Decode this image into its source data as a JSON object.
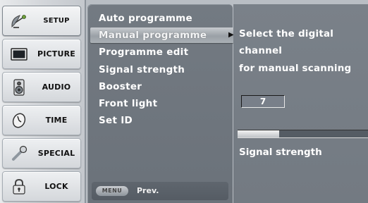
{
  "sidebar": {
    "items": [
      {
        "label": "SETUP",
        "icon": "satellite-dish-icon",
        "active": true
      },
      {
        "label": "PICTURE",
        "icon": "monitor-icon",
        "active": false
      },
      {
        "label": "AUDIO",
        "icon": "speaker-icon",
        "active": false
      },
      {
        "label": "TIME",
        "icon": "clock-icon",
        "active": false
      },
      {
        "label": "SPECIAL",
        "icon": "wrench-icon",
        "active": false
      },
      {
        "label": "LOCK",
        "icon": "padlock-icon",
        "active": false
      }
    ]
  },
  "menu": {
    "items": [
      {
        "label": "Auto programme"
      },
      {
        "label": "Manual programme",
        "selected": true
      },
      {
        "label": "Programme edit"
      },
      {
        "label": "Signal strength"
      },
      {
        "label": "Booster"
      },
      {
        "label": "Front light"
      },
      {
        "label": "Set ID"
      }
    ],
    "submenu_arrow": "▶",
    "footer": {
      "key_label": "MENU",
      "action_label": "Prev."
    }
  },
  "info": {
    "lines": [
      "Select the digital",
      "channel",
      "for manual scanning"
    ],
    "channel_value": "7",
    "signal_level": 0.32,
    "signal_label": "Signal strength"
  },
  "colors": {
    "panel": "#737a82",
    "sidebar": "#d3d6da",
    "highlight": "#aab0b5",
    "text": "#ffffff"
  }
}
